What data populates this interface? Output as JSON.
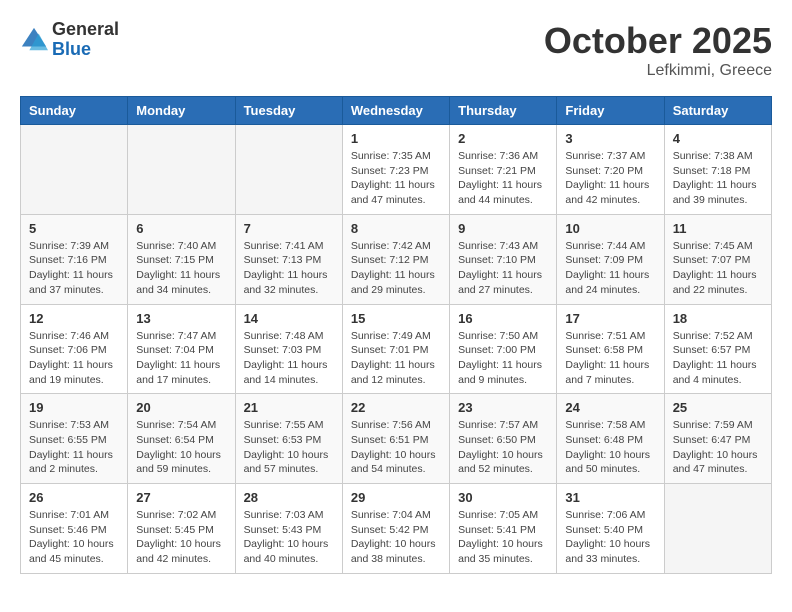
{
  "header": {
    "logo_general": "General",
    "logo_blue": "Blue",
    "month_title": "October 2025",
    "location": "Lefkimmi, Greece"
  },
  "days_of_week": [
    "Sunday",
    "Monday",
    "Tuesday",
    "Wednesday",
    "Thursday",
    "Friday",
    "Saturday"
  ],
  "weeks": [
    [
      {
        "day": "",
        "info": ""
      },
      {
        "day": "",
        "info": ""
      },
      {
        "day": "",
        "info": ""
      },
      {
        "day": "1",
        "info": "Sunrise: 7:35 AM\nSunset: 7:23 PM\nDaylight: 11 hours and 47 minutes."
      },
      {
        "day": "2",
        "info": "Sunrise: 7:36 AM\nSunset: 7:21 PM\nDaylight: 11 hours and 44 minutes."
      },
      {
        "day": "3",
        "info": "Sunrise: 7:37 AM\nSunset: 7:20 PM\nDaylight: 11 hours and 42 minutes."
      },
      {
        "day": "4",
        "info": "Sunrise: 7:38 AM\nSunset: 7:18 PM\nDaylight: 11 hours and 39 minutes."
      }
    ],
    [
      {
        "day": "5",
        "info": "Sunrise: 7:39 AM\nSunset: 7:16 PM\nDaylight: 11 hours and 37 minutes."
      },
      {
        "day": "6",
        "info": "Sunrise: 7:40 AM\nSunset: 7:15 PM\nDaylight: 11 hours and 34 minutes."
      },
      {
        "day": "7",
        "info": "Sunrise: 7:41 AM\nSunset: 7:13 PM\nDaylight: 11 hours and 32 minutes."
      },
      {
        "day": "8",
        "info": "Sunrise: 7:42 AM\nSunset: 7:12 PM\nDaylight: 11 hours and 29 minutes."
      },
      {
        "day": "9",
        "info": "Sunrise: 7:43 AM\nSunset: 7:10 PM\nDaylight: 11 hours and 27 minutes."
      },
      {
        "day": "10",
        "info": "Sunrise: 7:44 AM\nSunset: 7:09 PM\nDaylight: 11 hours and 24 minutes."
      },
      {
        "day": "11",
        "info": "Sunrise: 7:45 AM\nSunset: 7:07 PM\nDaylight: 11 hours and 22 minutes."
      }
    ],
    [
      {
        "day": "12",
        "info": "Sunrise: 7:46 AM\nSunset: 7:06 PM\nDaylight: 11 hours and 19 minutes."
      },
      {
        "day": "13",
        "info": "Sunrise: 7:47 AM\nSunset: 7:04 PM\nDaylight: 11 hours and 17 minutes."
      },
      {
        "day": "14",
        "info": "Sunrise: 7:48 AM\nSunset: 7:03 PM\nDaylight: 11 hours and 14 minutes."
      },
      {
        "day": "15",
        "info": "Sunrise: 7:49 AM\nSunset: 7:01 PM\nDaylight: 11 hours and 12 minutes."
      },
      {
        "day": "16",
        "info": "Sunrise: 7:50 AM\nSunset: 7:00 PM\nDaylight: 11 hours and 9 minutes."
      },
      {
        "day": "17",
        "info": "Sunrise: 7:51 AM\nSunset: 6:58 PM\nDaylight: 11 hours and 7 minutes."
      },
      {
        "day": "18",
        "info": "Sunrise: 7:52 AM\nSunset: 6:57 PM\nDaylight: 11 hours and 4 minutes."
      }
    ],
    [
      {
        "day": "19",
        "info": "Sunrise: 7:53 AM\nSunset: 6:55 PM\nDaylight: 11 hours and 2 minutes."
      },
      {
        "day": "20",
        "info": "Sunrise: 7:54 AM\nSunset: 6:54 PM\nDaylight: 10 hours and 59 minutes."
      },
      {
        "day": "21",
        "info": "Sunrise: 7:55 AM\nSunset: 6:53 PM\nDaylight: 10 hours and 57 minutes."
      },
      {
        "day": "22",
        "info": "Sunrise: 7:56 AM\nSunset: 6:51 PM\nDaylight: 10 hours and 54 minutes."
      },
      {
        "day": "23",
        "info": "Sunrise: 7:57 AM\nSunset: 6:50 PM\nDaylight: 10 hours and 52 minutes."
      },
      {
        "day": "24",
        "info": "Sunrise: 7:58 AM\nSunset: 6:48 PM\nDaylight: 10 hours and 50 minutes."
      },
      {
        "day": "25",
        "info": "Sunrise: 7:59 AM\nSunset: 6:47 PM\nDaylight: 10 hours and 47 minutes."
      }
    ],
    [
      {
        "day": "26",
        "info": "Sunrise: 7:01 AM\nSunset: 5:46 PM\nDaylight: 10 hours and 45 minutes."
      },
      {
        "day": "27",
        "info": "Sunrise: 7:02 AM\nSunset: 5:45 PM\nDaylight: 10 hours and 42 minutes."
      },
      {
        "day": "28",
        "info": "Sunrise: 7:03 AM\nSunset: 5:43 PM\nDaylight: 10 hours and 40 minutes."
      },
      {
        "day": "29",
        "info": "Sunrise: 7:04 AM\nSunset: 5:42 PM\nDaylight: 10 hours and 38 minutes."
      },
      {
        "day": "30",
        "info": "Sunrise: 7:05 AM\nSunset: 5:41 PM\nDaylight: 10 hours and 35 minutes."
      },
      {
        "day": "31",
        "info": "Sunrise: 7:06 AM\nSunset: 5:40 PM\nDaylight: 10 hours and 33 minutes."
      },
      {
        "day": "",
        "info": ""
      }
    ]
  ]
}
